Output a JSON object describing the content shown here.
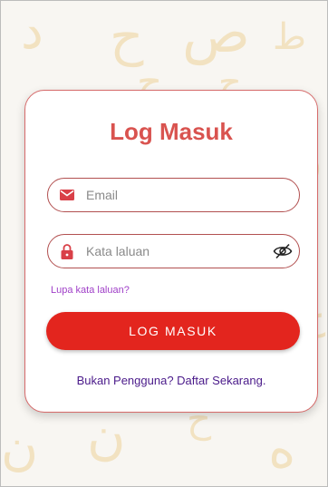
{
  "login": {
    "title": "Log Masuk",
    "email_placeholder": "Email",
    "password_placeholder": "Kata laluan",
    "forgot_password": "Lupa kata laluan?",
    "submit_label": "LOG MASUK",
    "signup_prompt": "Bukan Pengguna? Daftar Sekarang."
  },
  "icons": {
    "email": "envelope-icon",
    "password": "lock-icon",
    "toggle_visibility": "eye-off-icon"
  },
  "colors": {
    "accent": "#e3251e",
    "title": "#d9534f",
    "field_border": "#b25050",
    "link": "#a040c8",
    "signup_text": "#4a1a8a",
    "background_letters": "#f1dfb9"
  }
}
